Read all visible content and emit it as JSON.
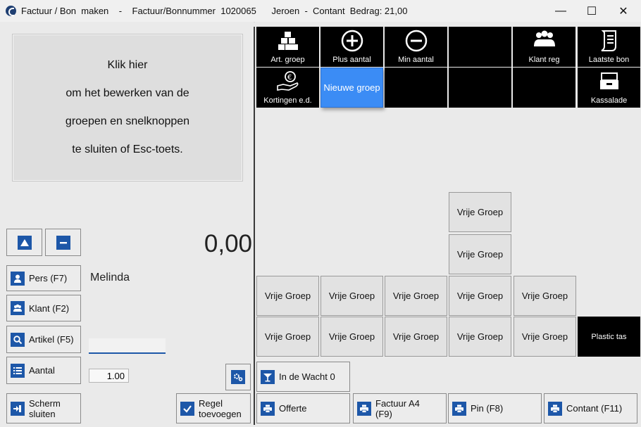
{
  "window": {
    "title": "Factuur / Bon  maken    -    Factuur/Bonnummer  1020065      Jeroen  -  Contant  Bedrag: 21,00",
    "controls": {
      "minimize": "—",
      "maximize": "☐",
      "close": "✕"
    }
  },
  "info": {
    "lines": [
      "Klik hier",
      "om het bewerken van de",
      "groepen en snelknoppen",
      "te sluiten of Esc-toets."
    ]
  },
  "amount": "0,00",
  "customer": "Melinda",
  "quantity_value": "1.00",
  "left_buttons": {
    "pers": "Pers (F7)",
    "klant": "Klant (F2)",
    "artikel": "Artikel (F5)",
    "aantal": "Aantal",
    "scherm_line1": "Scherm",
    "scherm_line2": "sluiten",
    "regel_line1": "Regel",
    "regel_line2": "toevoegen"
  },
  "top_tiles": {
    "art_groep": "Art. groep",
    "plus_aantal": "Plus aantal",
    "min_aantal": "Min aantal",
    "klant_reg": "Klant reg",
    "laatste_bon": "Laatste bon",
    "kortingen": "Kortingen e.d.",
    "nieuwe_groep": "Nieuwe groep",
    "kassalade": "Kassalade"
  },
  "group_label": "Vrije Groep",
  "plastic_tas": "Plastic tas",
  "bottom_buttons": {
    "wacht": "In de Wacht 0",
    "offerte": "Offerte",
    "factuur_line1": "Factuur A4",
    "factuur_line2": "(F9)",
    "pin": "Pin (F8)",
    "contant": "Contant (F11)"
  }
}
